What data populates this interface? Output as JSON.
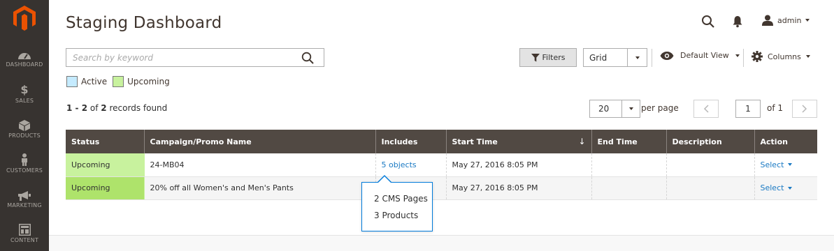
{
  "sidebar": {
    "logo": "magento-logo",
    "items": [
      {
        "label": "DASHBOARD",
        "icon": "speedometer-icon"
      },
      {
        "label": "SALES",
        "icon": "dollar-icon"
      },
      {
        "label": "PRODUCTS",
        "icon": "box-icon"
      },
      {
        "label": "CUSTOMERS",
        "icon": "person-icon"
      },
      {
        "label": "MARKETING",
        "icon": "megaphone-icon"
      },
      {
        "label": "CONTENT",
        "icon": "layout-icon"
      }
    ]
  },
  "header": {
    "title": "Staging Dashboard",
    "user": "admin"
  },
  "search": {
    "placeholder": "Search by keyword"
  },
  "toolbar": {
    "filters_label": "Filters",
    "view_mode": "Grid",
    "default_view": "Default View",
    "columns_label": "Columns"
  },
  "legend": {
    "active": "Active",
    "upcoming": "Upcoming"
  },
  "records": {
    "from": "1",
    "to": "2",
    "total": "2",
    "text_of": "of",
    "text_found": "records found"
  },
  "pager": {
    "per_page": "20",
    "per_page_label": "per page",
    "current": "1",
    "of_label": "of 1"
  },
  "table": {
    "headers": [
      "Status",
      "Campaign/Promo Name",
      "Includes",
      "Start Time",
      "End Time",
      "Description",
      "Action"
    ],
    "rows": [
      {
        "status": "Upcoming",
        "name": "24-MB04",
        "includes": "5 objects",
        "start": "May 27, 2016 8:05 PM",
        "end": "",
        "description": "",
        "action": "Select"
      },
      {
        "status": "Upcoming",
        "name": "20% off all Women's and Men's Pants",
        "includes": "",
        "start": "May 27, 2016 8:05 PM",
        "end": "",
        "description": "",
        "action": "Select"
      }
    ]
  },
  "popup": {
    "line1": "2 CMS Pages",
    "line2": "3 Products"
  },
  "colors": {
    "sidebar_bg": "#373330",
    "header_row": "#514943",
    "upcoming": "#c8f29e",
    "active": "#c5ebff",
    "link": "#1979c3",
    "logo": "#eb5202"
  }
}
